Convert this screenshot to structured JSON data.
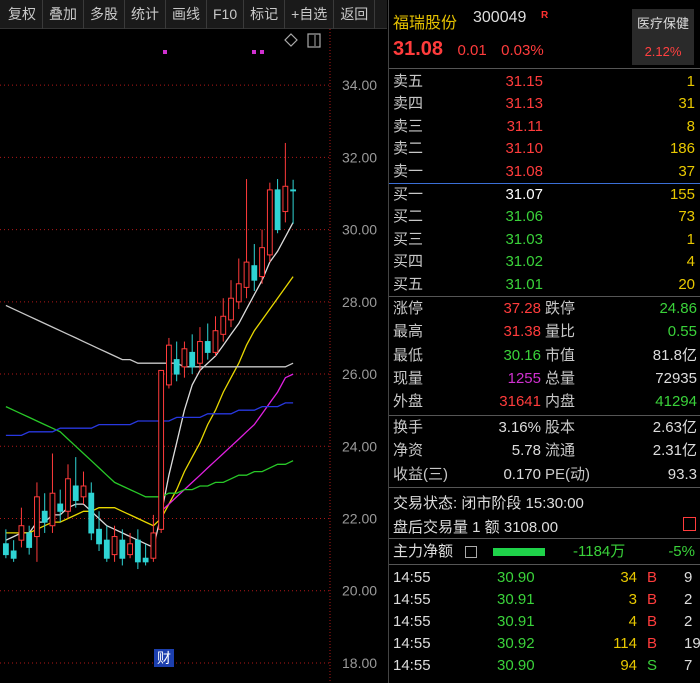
{
  "toolbar": {
    "items": [
      "复权",
      "叠加",
      "多股",
      "统计",
      "画线",
      "F10",
      "标记",
      "+自选",
      "返回"
    ]
  },
  "chart": {
    "y_labels": [
      "34.00",
      "32.00",
      "30.00",
      "28.00",
      "26.00",
      "24.00",
      "22.00",
      "20.00",
      "18.00"
    ],
    "event_marker": "财",
    "colors": {
      "up": "#ff3b3b",
      "down": "#2fd4d4",
      "ma_white": "#dcdcdc",
      "ma_yellow": "#e8d800",
      "ma_magenta": "#e020e0",
      "ma_green": "#28c828",
      "ma_blue": "#2838e0",
      "ma_gray": "#c8c8c8",
      "grid": "#b01818"
    }
  },
  "chart_data": {
    "type": "candlestick",
    "ylim": [
      17.5,
      35.5
    ],
    "candles": [
      {
        "o": 21.3,
        "c": 21.0,
        "h": 21.7,
        "l": 20.9
      },
      {
        "o": 21.1,
        "c": 20.9,
        "h": 21.4,
        "l": 20.8
      },
      {
        "o": 21.4,
        "c": 21.8,
        "h": 22.3,
        "l": 21.2
      },
      {
        "o": 21.6,
        "c": 21.2,
        "h": 21.8,
        "l": 21.0
      },
      {
        "o": 21.5,
        "c": 22.6,
        "h": 23.0,
        "l": 20.8
      },
      {
        "o": 22.2,
        "c": 21.9,
        "h": 22.7,
        "l": 21.6
      },
      {
        "o": 21.8,
        "c": 22.7,
        "h": 23.8,
        "l": 21.6
      },
      {
        "o": 22.4,
        "c": 22.2,
        "h": 22.8,
        "l": 21.9
      },
      {
        "o": 22.2,
        "c": 23.1,
        "h": 23.5,
        "l": 22.0
      },
      {
        "o": 22.9,
        "c": 22.5,
        "h": 23.7,
        "l": 22.3
      },
      {
        "o": 22.6,
        "c": 22.9,
        "h": 23.3,
        "l": 22.4
      },
      {
        "o": 22.7,
        "c": 21.6,
        "h": 23.0,
        "l": 21.4
      },
      {
        "o": 21.7,
        "c": 21.3,
        "h": 22.2,
        "l": 21.1
      },
      {
        "o": 21.4,
        "c": 20.9,
        "h": 21.8,
        "l": 20.8
      },
      {
        "o": 21.0,
        "c": 21.5,
        "h": 21.8,
        "l": 20.8
      },
      {
        "o": 21.4,
        "c": 20.9,
        "h": 21.7,
        "l": 20.7
      },
      {
        "o": 21.0,
        "c": 21.3,
        "h": 21.6,
        "l": 20.9
      },
      {
        "o": 21.4,
        "c": 20.8,
        "h": 21.7,
        "l": 20.6
      },
      {
        "o": 20.9,
        "c": 20.8,
        "h": 21.3,
        "l": 20.7
      },
      {
        "o": 20.9,
        "c": 21.6,
        "h": 22.1,
        "l": 20.8
      },
      {
        "o": 21.7,
        "c": 26.1,
        "h": 26.1,
        "l": 21.6
      },
      {
        "o": 25.7,
        "c": 26.8,
        "h": 27.0,
        "l": 25.6
      },
      {
        "o": 26.4,
        "c": 26.0,
        "h": 26.9,
        "l": 25.8
      },
      {
        "o": 26.2,
        "c": 26.7,
        "h": 26.9,
        "l": 25.9
      },
      {
        "o": 26.6,
        "c": 26.2,
        "h": 27.1,
        "l": 26.0
      },
      {
        "o": 26.3,
        "c": 26.9,
        "h": 27.3,
        "l": 26.1
      },
      {
        "o": 26.9,
        "c": 26.6,
        "h": 27.4,
        "l": 26.4
      },
      {
        "o": 26.6,
        "c": 27.2,
        "h": 27.6,
        "l": 26.5
      },
      {
        "o": 27.1,
        "c": 27.6,
        "h": 28.1,
        "l": 26.9
      },
      {
        "o": 27.5,
        "c": 28.1,
        "h": 28.6,
        "l": 27.3
      },
      {
        "o": 28.0,
        "c": 28.5,
        "h": 29.2,
        "l": 27.8
      },
      {
        "o": 28.4,
        "c": 29.1,
        "h": 31.4,
        "l": 28.1
      },
      {
        "o": 29.0,
        "c": 28.6,
        "h": 29.6,
        "l": 28.3
      },
      {
        "o": 28.7,
        "c": 29.5,
        "h": 30.0,
        "l": 28.5
      },
      {
        "o": 29.3,
        "c": 31.1,
        "h": 31.3,
        "l": 29.1
      },
      {
        "o": 31.1,
        "c": 30.0,
        "h": 31.4,
        "l": 29.9
      },
      {
        "o": 30.5,
        "c": 31.2,
        "h": 32.4,
        "l": 30.2
      },
      {
        "o": 31.1,
        "c": 31.08,
        "h": 31.38,
        "l": 30.16
      }
    ],
    "ma_lines": [
      {
        "color": "ma_white",
        "values": [
          21.4,
          21.5,
          21.6,
          21.6,
          21.9,
          21.9,
          22.1,
          22.1,
          22.3,
          22.4,
          22.4,
          22.2,
          22.0,
          21.8,
          21.7,
          21.6,
          21.5,
          21.4,
          21.3,
          21.2,
          22.1,
          23.2,
          24.1,
          25.0,
          25.7,
          26.1,
          26.3,
          26.5,
          26.8,
          27.1,
          27.4,
          27.8,
          28.2,
          28.6,
          29.1,
          29.4,
          29.8,
          30.2
        ]
      },
      {
        "color": "ma_yellow",
        "values": [
          21.6,
          21.6,
          21.6,
          21.6,
          21.7,
          21.8,
          21.9,
          21.9,
          22.0,
          22.1,
          22.2,
          22.2,
          22.3,
          22.3,
          22.3,
          22.2,
          22.1,
          22.0,
          21.9,
          21.8,
          22.0,
          22.4,
          22.8,
          23.3,
          23.7,
          24.1,
          24.6,
          25.0,
          25.5,
          25.9,
          26.3,
          26.8,
          27.2,
          27.5,
          27.8,
          28.1,
          28.4,
          28.7
        ]
      },
      {
        "color": "ma_magenta",
        "values": [
          null,
          null,
          null,
          null,
          null,
          null,
          null,
          null,
          null,
          null,
          null,
          null,
          null,
          null,
          null,
          null,
          null,
          null,
          null,
          null,
          22.2,
          22.4,
          22.6,
          22.8,
          23.0,
          23.2,
          23.4,
          23.6,
          23.8,
          24.0,
          24.2,
          24.4,
          24.6,
          24.9,
          25.2,
          25.5,
          25.9,
          26.0
        ]
      },
      {
        "color": "ma_green",
        "values": [
          25.1,
          25.0,
          24.9,
          24.8,
          24.7,
          24.6,
          24.5,
          24.4,
          24.2,
          24.0,
          23.8,
          23.6,
          23.4,
          23.2,
          23.0,
          22.9,
          22.8,
          22.7,
          22.6,
          22.6,
          22.6,
          22.7,
          22.7,
          22.8,
          22.8,
          22.9,
          22.9,
          23.0,
          23.0,
          23.1,
          23.2,
          23.2,
          23.3,
          23.3,
          23.4,
          23.5,
          23.5,
          23.6
        ]
      },
      {
        "color": "ma_blue",
        "values": [
          24.3,
          24.3,
          24.3,
          24.4,
          24.4,
          24.4,
          24.4,
          24.5,
          24.5,
          24.5,
          24.5,
          24.5,
          24.6,
          24.6,
          24.6,
          24.6,
          24.6,
          24.7,
          24.7,
          24.7,
          24.7,
          24.7,
          24.8,
          24.8,
          24.8,
          24.8,
          24.9,
          24.9,
          24.9,
          24.9,
          25.0,
          25.0,
          25.0,
          25.1,
          25.1,
          25.1,
          25.2,
          25.2
        ]
      },
      {
        "color": "ma_gray",
        "values": [
          27.9,
          27.8,
          27.7,
          27.6,
          27.5,
          27.4,
          27.3,
          27.2,
          27.1,
          27.0,
          26.9,
          26.8,
          26.7,
          26.6,
          26.5,
          26.4,
          26.4,
          26.3,
          26.3,
          26.3,
          26.3,
          26.3,
          26.3,
          26.2,
          26.2,
          26.2,
          26.2,
          26.2,
          26.2,
          26.2,
          26.2,
          26.2,
          26.2,
          26.2,
          26.2,
          26.2,
          26.2,
          26.3
        ]
      }
    ]
  },
  "header": {
    "name": "福瑞股份",
    "code": "300049",
    "badge": "R",
    "price": "31.08",
    "change": "0.01",
    "change_pct": "0.03%",
    "sector": "医疗保健",
    "sector_pct": "2.12%"
  },
  "orderbook": {
    "asks": [
      {
        "label": "卖五",
        "price": "31.15",
        "vol": "1"
      },
      {
        "label": "卖四",
        "price": "31.13",
        "vol": "31"
      },
      {
        "label": "卖三",
        "price": "31.11",
        "vol": "8"
      },
      {
        "label": "卖二",
        "price": "31.10",
        "vol": "186"
      },
      {
        "label": "卖一",
        "price": "31.08",
        "vol": "37"
      }
    ],
    "bids": [
      {
        "label": "买一",
        "price": "31.07",
        "vol": "155"
      },
      {
        "label": "买二",
        "price": "31.06",
        "vol": "73"
      },
      {
        "label": "买三",
        "price": "31.03",
        "vol": "1"
      },
      {
        "label": "买四",
        "price": "31.02",
        "vol": "4"
      },
      {
        "label": "买五",
        "price": "31.01",
        "vol": "20"
      }
    ]
  },
  "stats1": [
    {
      "l1": "涨停",
      "v1": "37.28",
      "c1": "#ff3c3c",
      "l2": "跌停",
      "v2": "24.86",
      "c2": "#3ad23a"
    },
    {
      "l1": "最高",
      "v1": "31.38",
      "c1": "#ff3c3c",
      "l2": "量比",
      "v2": "0.55",
      "c2": "#3ad23a"
    },
    {
      "l1": "最低",
      "v1": "30.16",
      "c1": "#3ad23a",
      "l2": "市值",
      "v2": "81.8亿",
      "c2": "#dddddd"
    },
    {
      "l1": "现量",
      "v1": "1255",
      "c1": "#d030d0",
      "l2": "总量",
      "v2": "72935",
      "c2": "#dddddd"
    },
    {
      "l1": "外盘",
      "v1": "31641",
      "c1": "#ff3c3c",
      "l2": "内盘",
      "v2": "41294",
      "c2": "#3ad23a"
    }
  ],
  "stats2": [
    {
      "l1": "换手",
      "v1": "3.16%",
      "c1": "#dddddd",
      "l2": "股本",
      "v2": "2.63亿",
      "c2": "#dddddd"
    },
    {
      "l1": "净资",
      "v1": "5.78",
      "c1": "#dddddd",
      "l2": "流通",
      "v2": "2.31亿",
      "c2": "#dddddd"
    },
    {
      "l1": "收益(三)",
      "v1": "0.170",
      "c1": "#dddddd",
      "l2": "PE(动)",
      "v2": "93.3",
      "c2": "#dddddd"
    }
  ],
  "trade_status": {
    "status": "交易状态: 闭市阶段 15:30:00",
    "after_hours": "盘后交易量 1 额 3108.00"
  },
  "flow": {
    "label": "主力净额",
    "value": "-1184万",
    "pct": "-5%"
  },
  "ticks": [
    {
      "time": "14:55",
      "price": "30.90",
      "vol": "34",
      "bs": "B",
      "bs_color": "#ff3c3c",
      "n": "9"
    },
    {
      "time": "14:55",
      "price": "30.91",
      "vol": "3",
      "bs": "B",
      "bs_color": "#ff3c3c",
      "n": "2"
    },
    {
      "time": "14:55",
      "price": "30.91",
      "vol": "4",
      "bs": "B",
      "bs_color": "#ff3c3c",
      "n": "2"
    },
    {
      "time": "14:55",
      "price": "30.92",
      "vol": "114",
      "bs": "B",
      "bs_color": "#ff3c3c",
      "n": "19"
    },
    {
      "time": "14:55",
      "price": "30.90",
      "vol": "94",
      "bs": "S",
      "bs_color": "#3ad23a",
      "n": "7"
    }
  ]
}
